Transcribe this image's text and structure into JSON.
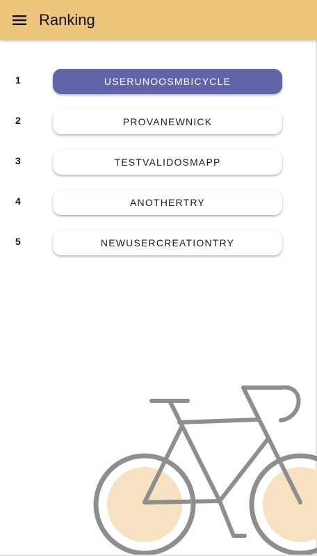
{
  "header": {
    "title": "Ranking",
    "menu_icon": "hamburger-menu-icon"
  },
  "ranking": [
    {
      "rank": "1",
      "username": "USERUNOOSMBICYCLE",
      "selected": true
    },
    {
      "rank": "2",
      "username": "PROVANEWNICK",
      "selected": false
    },
    {
      "rank": "3",
      "username": "TESTVALIDOSMAPP",
      "selected": false
    },
    {
      "rank": "4",
      "username": "ANOTHERTRY",
      "selected": false
    },
    {
      "rank": "5",
      "username": "NEWUSERCREATIONTRY",
      "selected": false
    }
  ],
  "illustration": {
    "icon": "bicycle-illustration",
    "frame_color": "#8e8e8e",
    "wheel_fill_color": "#f6e2c0"
  },
  "colors": {
    "app_bar": "#ecc47b",
    "selected_button": "#6264aa",
    "button": "#ffffff"
  }
}
